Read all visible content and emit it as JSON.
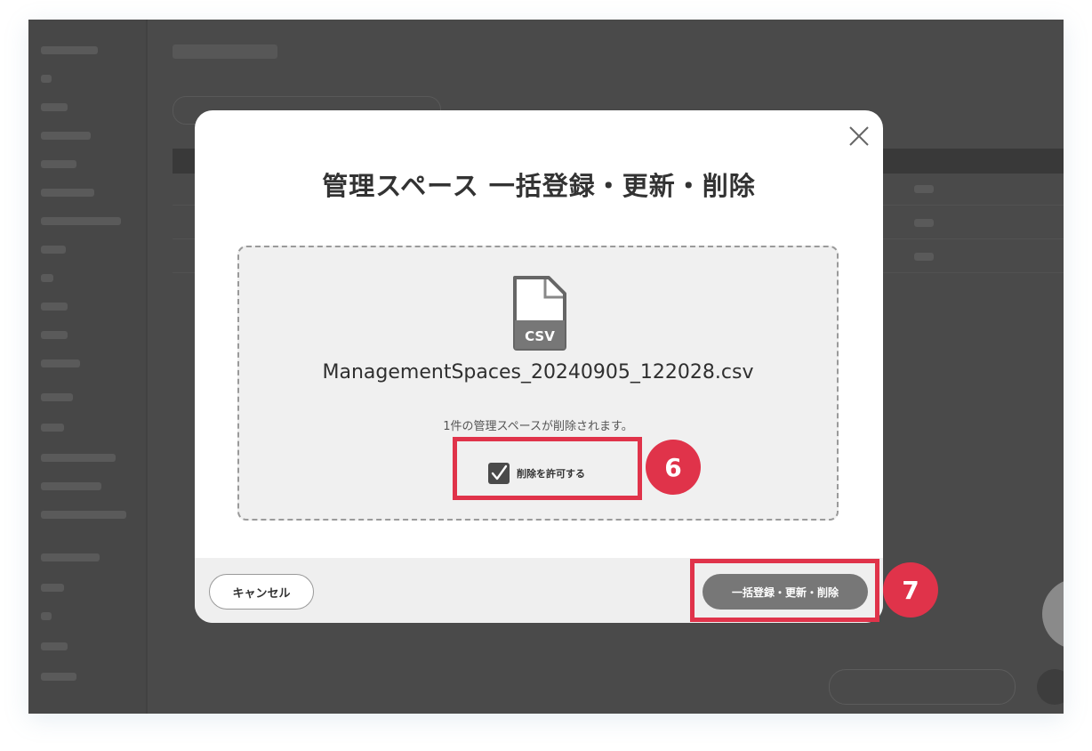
{
  "modal": {
    "title": "管理スペース 一括登録・更新・削除",
    "file_type_label": "CSV",
    "file_name": "ManagementSpaces_20240905_122028.csv",
    "delete_message": "1件の管理スペースが削除されます。",
    "allow_delete_label": "削除を許可する",
    "allow_delete_checked": true,
    "cancel_label": "キャンセル",
    "submit_label": "一括登録・更新・削除"
  },
  "annotations": {
    "step_checkbox": "6",
    "step_submit": "7",
    "color": "#e0334a"
  }
}
